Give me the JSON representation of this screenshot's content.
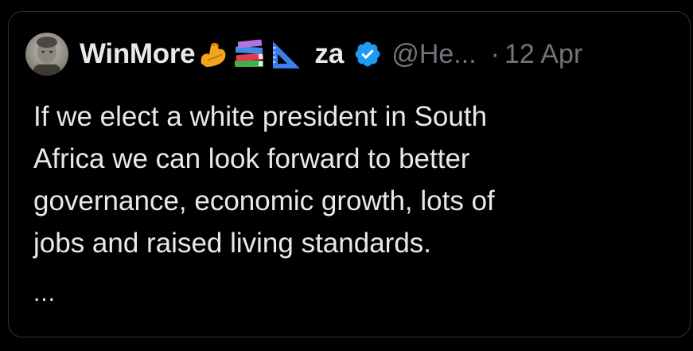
{
  "tweet": {
    "author": {
      "display_name": "WinMore",
      "emoji": [
        "flexed-biceps",
        "books",
        "triangular-ruler"
      ],
      "name_suffix": "za",
      "verified": true,
      "verified_color": "#1d9bf0",
      "handle": "@He...",
      "avatar_icon": "profile-photo"
    },
    "separator": "·",
    "date": "12 Apr",
    "text_lines": [
      "If we elect a white president in South",
      "Africa we can look forward to better",
      "governance, economic growth, lots of",
      "jobs and raised living standards."
    ],
    "truncation": "..."
  },
  "colors": {
    "background": "#000000",
    "text_primary": "#e7e9ea",
    "text_secondary": "#71767b",
    "border": "#2f3336",
    "accent": "#1d9bf0"
  }
}
